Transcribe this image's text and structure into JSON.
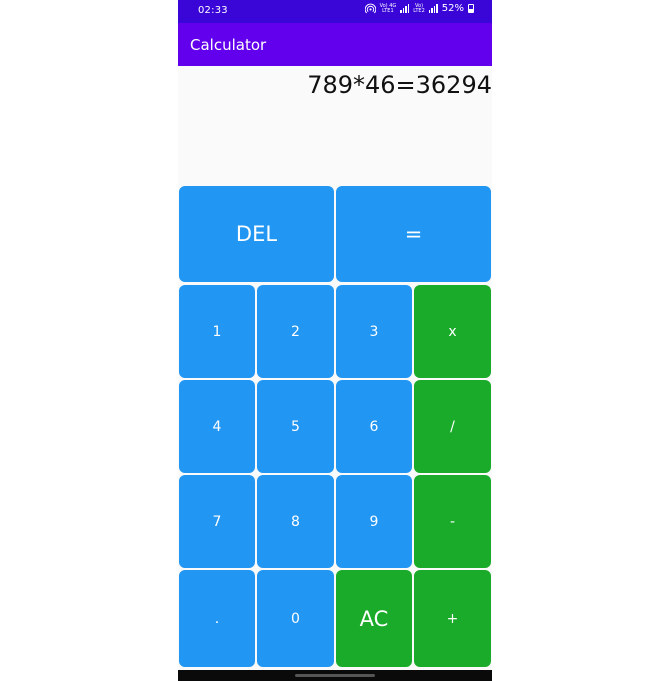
{
  "status_bar": {
    "time": "02:33",
    "network1_top": "Vo)",
    "network1_type": "4G",
    "network1_bottom": "LTE1",
    "network2_top": "Vo)",
    "network2_bottom": "LTE2",
    "battery": "52%",
    "icons": [
      "hotspot-icon",
      "signal-icon",
      "battery-icon"
    ]
  },
  "app_bar": {
    "title": "Calculator"
  },
  "display": {
    "expression": "789*46=36294"
  },
  "keys": {
    "del": "DEL",
    "equals": "=",
    "k1": "1",
    "k2": "2",
    "k3": "3",
    "multiply": "x",
    "k4": "4",
    "k5": "5",
    "k6": "6",
    "divide": "/",
    "k7": "7",
    "k8": "8",
    "k9": "9",
    "minus": "-",
    "dot": ".",
    "k0": "0",
    "ac": "AC",
    "plus": "+"
  },
  "colors": {
    "status_bar": "#3a06d8",
    "app_bar": "#6200ee",
    "digit_key": "#2196f3",
    "operator_key": "#1aab2a"
  }
}
